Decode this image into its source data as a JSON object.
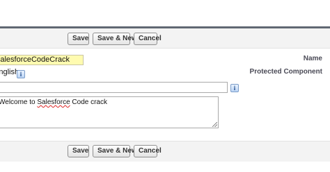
{
  "toolbar": {
    "save_label": "Save",
    "save_new_label": "Save & New",
    "cancel_label": "Cancel"
  },
  "form": {
    "name_label": "Name",
    "protected_label": "Protected Component",
    "name_value": "SalesforceCodeCrack",
    "language_value": "English",
    "description_value": "",
    "value_text_prefix": "Welcome to ",
    "value_text_misspelled": "Salesforce",
    "value_text_suffix": " Code crack",
    "info_icon_glyph": "i"
  },
  "icons": {
    "info": "info-icon",
    "resize": "resize-handle-icon"
  },
  "colors": {
    "top_border": "#606873",
    "button_bar_bg": "#f3f3f3",
    "required_field_bg": "#fffbb0",
    "spellcheck": "#d22222"
  }
}
